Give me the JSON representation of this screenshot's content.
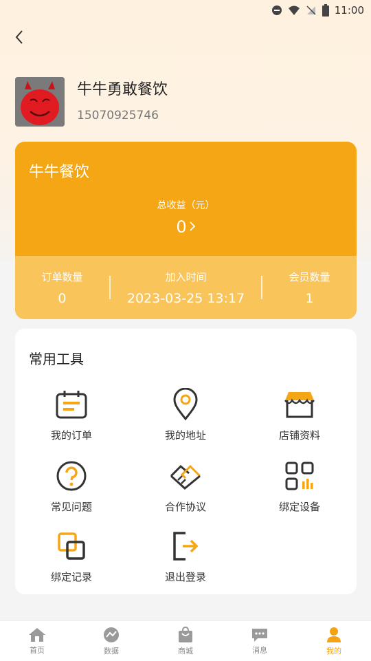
{
  "status": {
    "time": "11:00"
  },
  "profile": {
    "name": "牛牛勇敢餐饮",
    "phone": "15070925746"
  },
  "stats_card": {
    "title": "牛牛餐饮",
    "income_label": "总收益（元）",
    "income_value": "0",
    "items": [
      {
        "label": "订单数量",
        "value": "0"
      },
      {
        "label": "加入时间",
        "value": "2023-03-25 13:17"
      },
      {
        "label": "会员数量",
        "value": "1"
      }
    ]
  },
  "tools": {
    "title": "常用工具",
    "items": [
      {
        "label": "我的订单",
        "icon": "calendar-icon"
      },
      {
        "label": "我的地址",
        "icon": "location-pin-icon"
      },
      {
        "label": "店铺资料",
        "icon": "store-icon"
      },
      {
        "label": "常见问题",
        "icon": "question-icon"
      },
      {
        "label": "合作协议",
        "icon": "handshake-icon"
      },
      {
        "label": "绑定设备",
        "icon": "device-grid-icon"
      },
      {
        "label": "绑定记录",
        "icon": "copy-record-icon"
      },
      {
        "label": "退出登录",
        "icon": "logout-icon"
      }
    ]
  },
  "tabbar": {
    "active": 4,
    "items": [
      {
        "label": "首页",
        "icon": "home-icon"
      },
      {
        "label": "数据",
        "icon": "chart-icon"
      },
      {
        "label": "商城",
        "icon": "shop-bag-icon"
      },
      {
        "label": "消息",
        "icon": "message-icon"
      },
      {
        "label": "我的",
        "icon": "user-icon"
      }
    ]
  },
  "colors": {
    "accent": "#f5a615",
    "accent_light": "#f9c45a"
  }
}
